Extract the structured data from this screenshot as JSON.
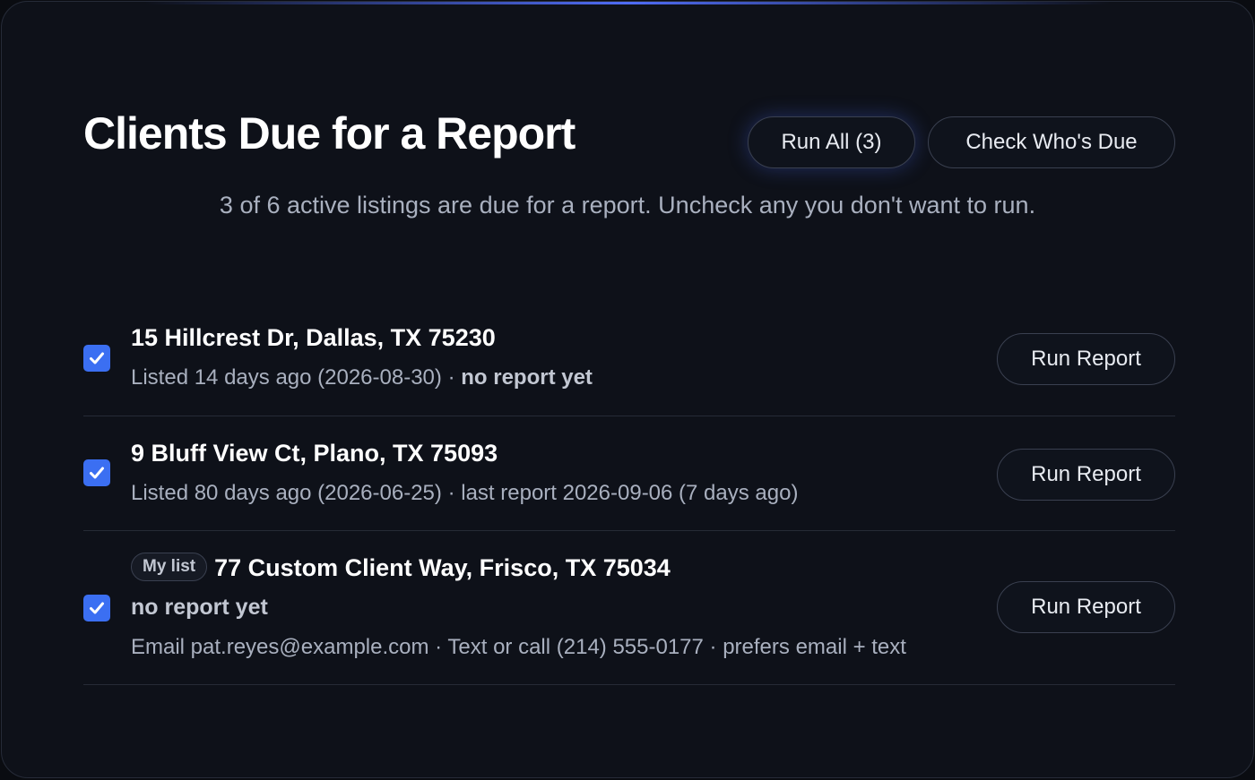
{
  "header": {
    "title": "Clients Due for a Report",
    "run_all_label": "Run All (3)",
    "check_due_label": "Check Who's Due",
    "subtitle": "3 of 6 active listings are due for a report. Uncheck any you don't want to run."
  },
  "colors": {
    "accent": "#3b6ff2",
    "background": "#0e1119"
  },
  "listings": [
    {
      "checked": true,
      "address": "15 Hillcrest Dr, Dallas, TX 75230",
      "listed": "Listed 14 days ago (2026-08-30)",
      "separator": " · ",
      "report_status": "no report yet",
      "action_label": "Run Report"
    },
    {
      "checked": true,
      "address": "9 Bluff View Ct, Plano, TX 75093",
      "listed": "Listed 80 days ago (2026-06-25)",
      "separator": " · ",
      "report_status": "last report 2026-09-06 (7 days ago)",
      "action_label": "Run Report"
    },
    {
      "checked": true,
      "tag": "My list",
      "address": "77 Custom Client Way, Frisco, TX 75034",
      "report_status": "no report yet",
      "contact": "Email pat.reyes@example.com · Text or call (214) 555-0177 · prefers email + text",
      "action_label": "Run Report"
    }
  ],
  "icons": {
    "checkbox": "checkmark-icon"
  }
}
